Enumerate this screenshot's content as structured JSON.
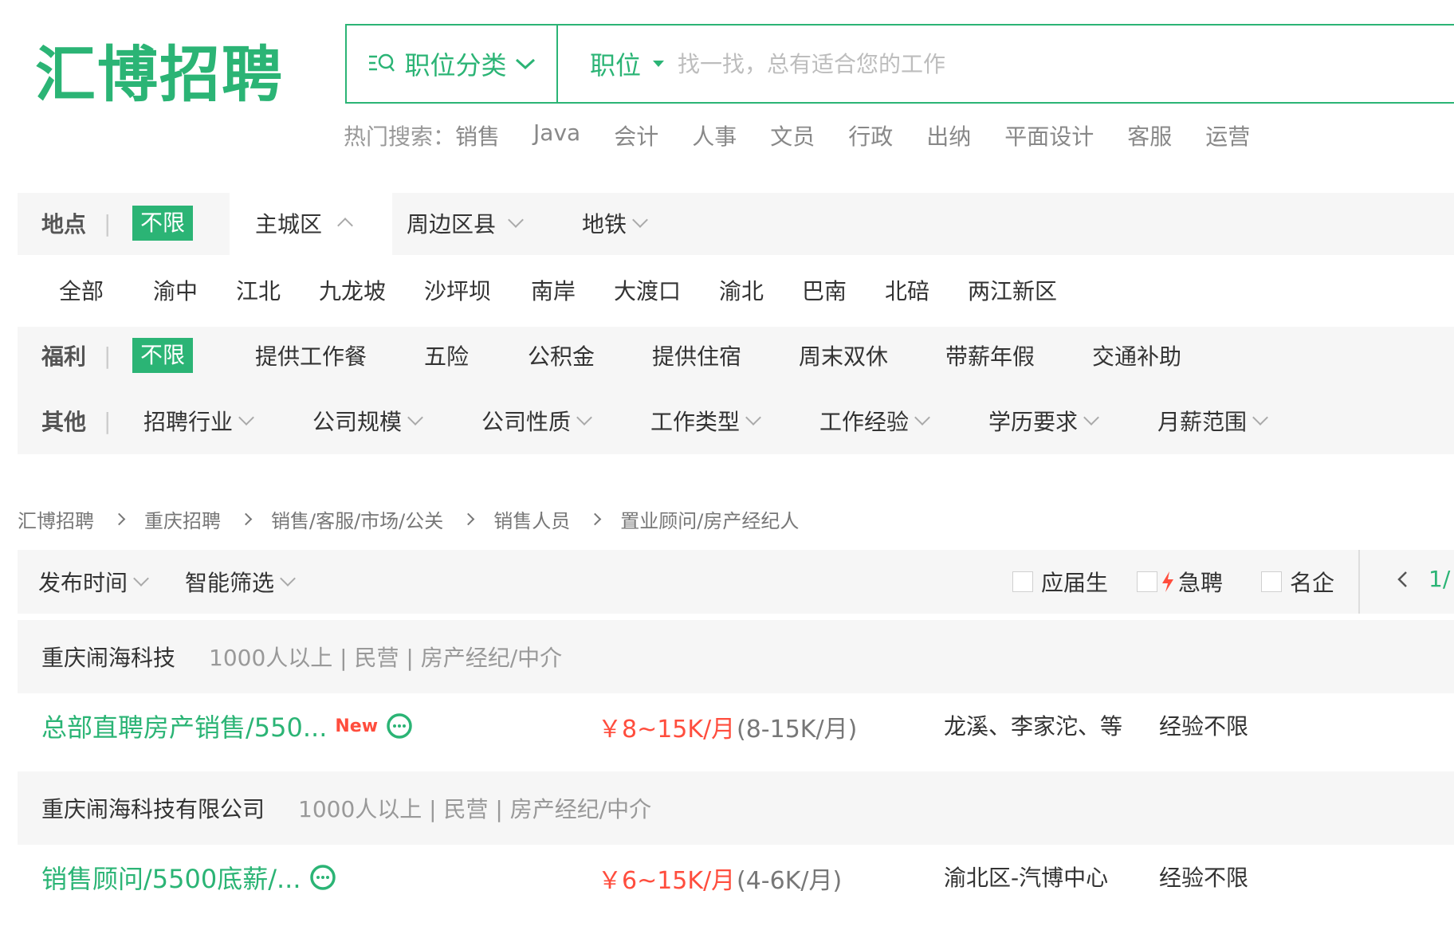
{
  "logo": "汇博招聘",
  "search": {
    "category_label": "职位分类",
    "type_label": "职位",
    "placeholder": "找一找，总有适合您的工作"
  },
  "hot_search": {
    "label": "热门搜索：",
    "items": [
      "销售",
      "Java",
      "会计",
      "人事",
      "文员",
      "行政",
      "出纳",
      "平面设计",
      "客服",
      "运营"
    ]
  },
  "filters": {
    "location": {
      "label": "地点",
      "all": "不限",
      "tabs": [
        "主城区",
        "周边区县",
        "地铁"
      ],
      "districts": [
        "全部",
        "渝中",
        "江北",
        "九龙坡",
        "沙坪坝",
        "南岸",
        "大渡口",
        "渝北",
        "巴南",
        "北碚",
        "两江新区"
      ]
    },
    "benefits": {
      "label": "福利",
      "all": "不限",
      "items": [
        "提供工作餐",
        "五险",
        "公积金",
        "提供住宿",
        "周末双休",
        "带薪年假",
        "交通补助"
      ]
    },
    "other": {
      "label": "其他",
      "items": [
        "招聘行业",
        "公司规模",
        "公司性质",
        "工作类型",
        "工作经验",
        "学历要求",
        "月薪范围"
      ]
    }
  },
  "breadcrumb": [
    "汇博招聘",
    "重庆招聘",
    "销售/客服/市场/公关",
    "销售人员",
    "置业顾问/房产经纪人"
  ],
  "sort_bar": {
    "publish_time": "发布时间",
    "smart_filter": "智能筛选",
    "checkboxes": [
      "应届生",
      "急聘",
      "名企"
    ],
    "pager": "1/"
  },
  "jobs": [
    {
      "company": "重庆闹海科技",
      "meta": "1000人以上 | 民营 | 房产经纪/中介",
      "title": "总部直聘房产销售/550...",
      "badge": "New",
      "salary": "￥8~15K/月",
      "salary_range": "(8-15K/月)",
      "location": "龙溪、李家沱、等",
      "experience": "经验不限"
    },
    {
      "company": "重庆闹海科技有限公司",
      "meta": "1000人以上 | 民营 | 房产经纪/中介",
      "title": "销售顾问/5500底薪/...",
      "badge": "",
      "salary": "￥6~15K/月",
      "salary_range": "(4-6K/月)",
      "location": "渝北区-汽博中心",
      "experience": "经验不限"
    }
  ],
  "colors": {
    "brand": "#2bb475",
    "salary": "#ff4d3d",
    "panel": "#f6f6f6"
  }
}
